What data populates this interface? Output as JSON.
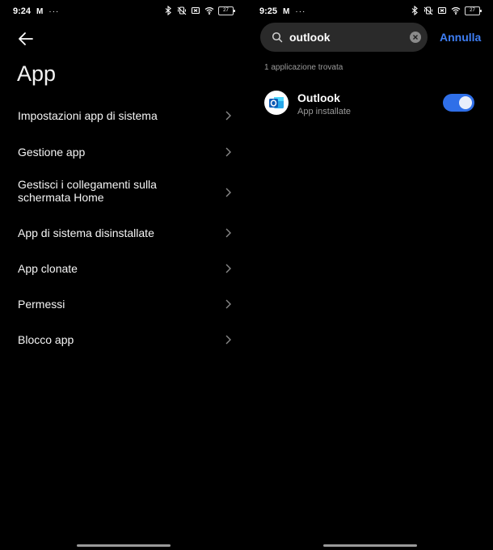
{
  "left": {
    "status": {
      "time": "9:24",
      "battery": "27"
    },
    "title": "App",
    "menu": [
      {
        "label": "Impostazioni app di sistema"
      },
      {
        "label": "Gestione app"
      },
      {
        "label": "Gestisci i collegamenti sulla schermata Home"
      },
      {
        "label": "App di sistema disinstallate"
      },
      {
        "label": "App clonate"
      },
      {
        "label": "Permessi"
      },
      {
        "label": "Blocco app"
      }
    ]
  },
  "right": {
    "status": {
      "time": "9:25",
      "battery": "27"
    },
    "search": {
      "value": "outlook"
    },
    "cancel_label": "Annulla",
    "results_count": "1 applicazione trovata",
    "result": {
      "name": "Outlook",
      "subtitle": "App installate",
      "toggle_on": true
    }
  },
  "colors": {
    "accent": "#3e7ef4",
    "toggle": "#2f6fe8",
    "background": "#000000",
    "search_bg": "#2a2a2a"
  },
  "icons": [
    "gmail-icon",
    "more-dots-icon",
    "bluetooth-icon",
    "vibrate-off-icon",
    "no-sim-icon",
    "wifi-icon",
    "battery-icon",
    "back-arrow-icon",
    "chevron-right-icon",
    "search-icon",
    "clear-icon",
    "outlook-app-icon"
  ]
}
